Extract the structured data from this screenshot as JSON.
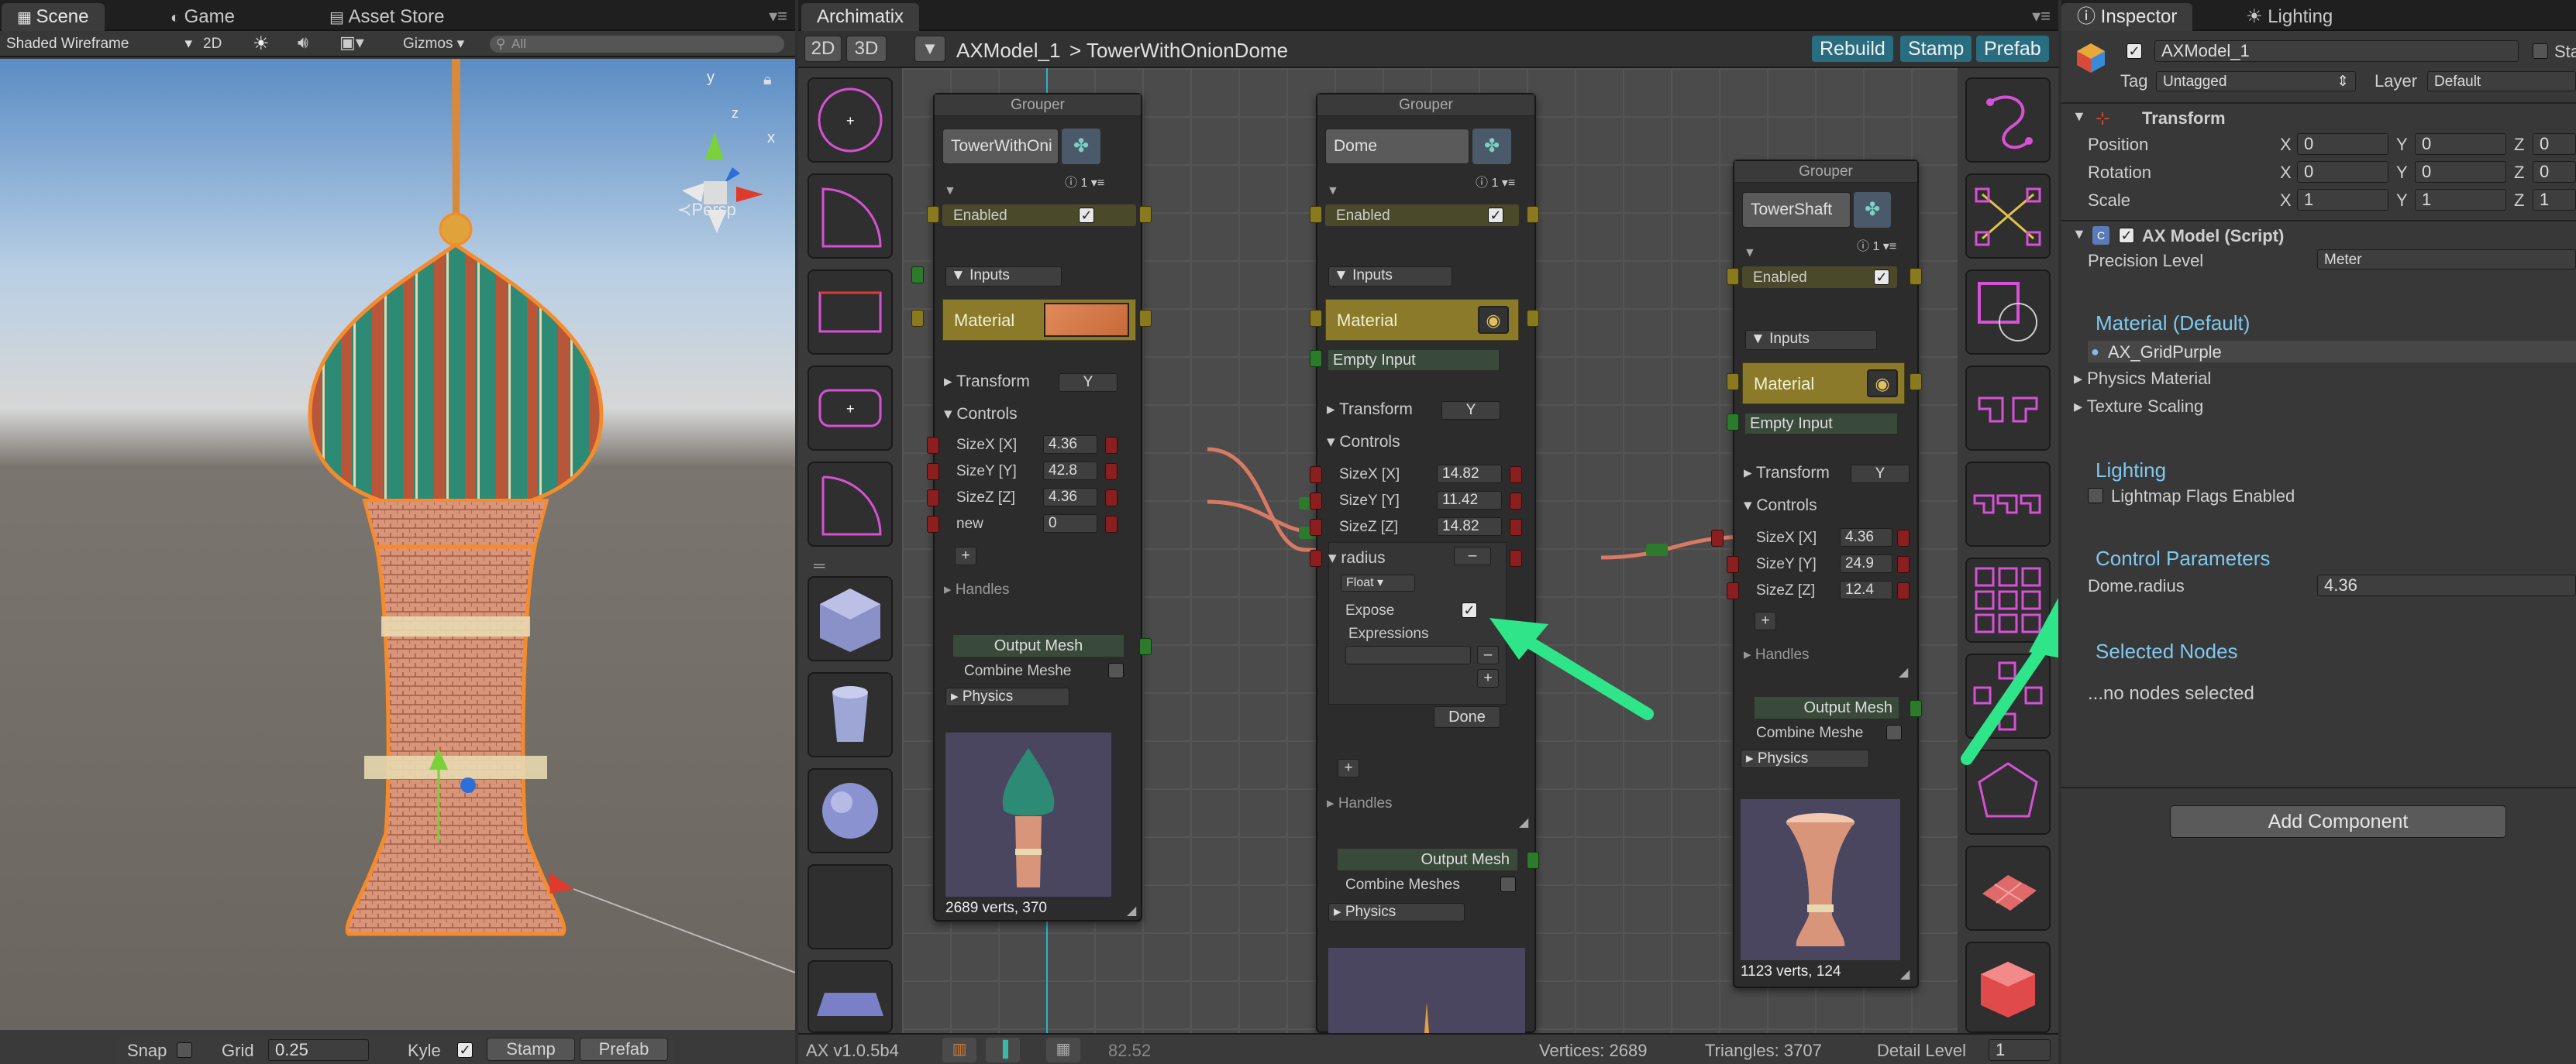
{
  "scene": {
    "tabs": [
      {
        "label": "Scene"
      },
      {
        "label": "Game"
      },
      {
        "label": "Asset Store"
      }
    ],
    "shading_mode": "Shaded Wireframe",
    "mode_2d": "2D",
    "gizmos_label": "Gizmos",
    "search_placeholder": "All",
    "view_label": "Persp",
    "gizmo_axes": {
      "x": "x",
      "y": "y",
      "z": "z"
    },
    "bottom_bar": {
      "snap_label": "Snap",
      "grid_label": "Grid",
      "grid_value": "0.25",
      "kyle_label": "Kyle",
      "stamp_label": "Stamp",
      "prefab_label": "Prefab"
    }
  },
  "archimatix": {
    "tab_label": "Archimatix",
    "toolbar": {
      "btn_2d": "2D",
      "btn_3d": "3D",
      "model_name": "AXModel_1",
      "breadcrumb": "> TowerWithOnionDome",
      "rebuild": "Rebuild",
      "stamp": "Stamp",
      "prefab": "Prefab"
    },
    "nodes": {
      "left": {
        "header": "Grouper",
        "name": "TowerWithOni",
        "info": "1",
        "enabled": "Enabled",
        "inputs": "Inputs",
        "material": "Material",
        "transform": "Transform",
        "transform_axis": "Y",
        "controls": "Controls",
        "params": [
          {
            "label": "SizeX [X]",
            "value": "4.36"
          },
          {
            "label": "SizeY [Y]",
            "value": "42.8"
          },
          {
            "label": "SizeZ [Z]",
            "value": "4.36"
          },
          {
            "label": "new",
            "value": "0"
          }
        ],
        "add": "+",
        "handles": "Handles",
        "output_mesh": "Output Mesh",
        "combine_meshes": "Combine Meshe",
        "physics": "Physics",
        "stats": "2689 verts, 370"
      },
      "center": {
        "header": "Grouper",
        "name": "Dome",
        "info": "1",
        "enabled": "Enabled",
        "inputs": "Inputs",
        "material": "Material",
        "empty_input": "Empty Input",
        "transform": "Transform",
        "transform_axis": "Y",
        "controls": "Controls",
        "params": [
          {
            "label": "SizeX [X]",
            "value": "14.82"
          },
          {
            "label": "SizeY [Y]",
            "value": "11.42"
          },
          {
            "label": "SizeZ [Z]",
            "value": "14.82"
          }
        ],
        "radius_label": "radius",
        "radius_minus": "–",
        "float_type": "Float",
        "expose": "Expose",
        "expressions": "Expressions",
        "expr_minus": "–",
        "expr_plus": "+",
        "done": "Done",
        "add": "+",
        "handles": "Handles",
        "output_mesh": "Output Mesh",
        "combine_meshes": "Combine Meshes",
        "physics": "Physics"
      },
      "right": {
        "header": "Grouper",
        "name": "TowerShaft",
        "info": "1",
        "enabled": "Enabled",
        "inputs": "Inputs",
        "material": "Material",
        "empty_input": "Empty Input",
        "transform": "Transform",
        "transform_axis": "Y",
        "controls": "Controls",
        "params": [
          {
            "label": "SizeX [X]",
            "value": "4.36"
          },
          {
            "label": "SizeY [Y]",
            "value": "24.9"
          },
          {
            "label": "SizeZ [Z]",
            "value": "12.4"
          }
        ],
        "add": "+",
        "handles": "Handles",
        "output_mesh": "Output Mesh",
        "combine_meshes": "Combine Meshe",
        "physics": "Physics",
        "stats": "1123 verts, 124"
      }
    },
    "status": {
      "version": "AX v1.0.5b4",
      "zoom": "82.52",
      "vertices": "Vertices: 2689",
      "triangles": "Triangles: 3707",
      "detail_label": "Detail Level",
      "detail_value": "1"
    }
  },
  "inspector": {
    "tabs": [
      {
        "label": "Inspector"
      },
      {
        "label": "Lighting"
      }
    ],
    "object_name": "AXModel_1",
    "static_label": "Sta",
    "tag_label": "Tag",
    "tag_value": "Untagged",
    "layer_label": "Layer",
    "layer_value": "Default",
    "transform": {
      "title": "Transform",
      "rows": [
        {
          "label": "Position",
          "x": "0",
          "y": "0",
          "z": "0"
        },
        {
          "label": "Rotation",
          "x": "0",
          "y": "0",
          "z": "0"
        },
        {
          "label": "Scale",
          "x": "1",
          "y": "1",
          "z": "1"
        }
      ],
      "axis_x": "X",
      "axis_y": "Y",
      "axis_z": "Z"
    },
    "ax_model": {
      "title": "AX Model (Script)",
      "precision_label": "Precision Level",
      "precision_value": "Meter"
    },
    "material_section": {
      "title": "Material (Default)",
      "value": "AX_GridPurple",
      "physics_material": "Physics Material",
      "texture_scaling": "Texture Scaling"
    },
    "lighting_section": {
      "title": "Lighting",
      "lightmap": "Lightmap Flags Enabled"
    },
    "control_params": {
      "title": "Control Parameters",
      "label": "Dome.radius",
      "value": "4.36"
    },
    "selected_nodes": {
      "title": "Selected Nodes",
      "text": "...no nodes selected"
    },
    "add_component": "Add Component"
  },
  "colors": {
    "accent": "#296d80",
    "arrow": "#2ee58a",
    "wire": "#e07a5f",
    "port_red": "#8a1f1f",
    "material": "#8a7a2a",
    "section_title": "#7fc8ef"
  }
}
